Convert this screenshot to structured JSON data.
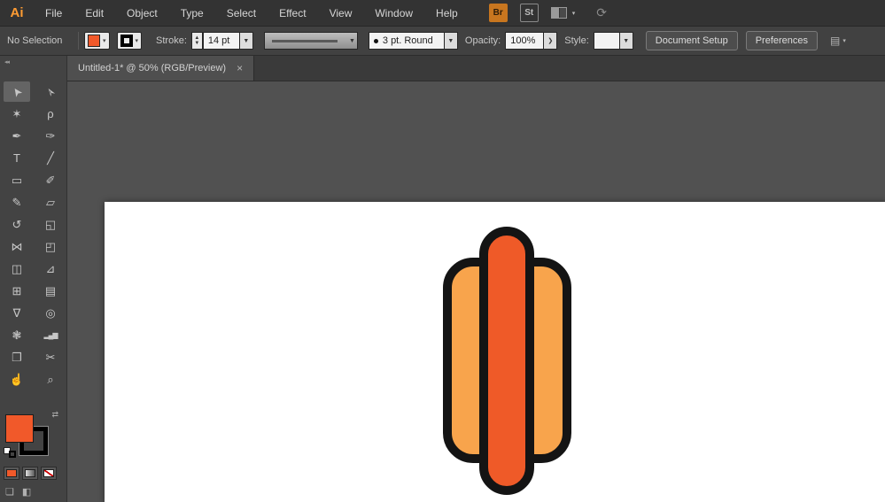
{
  "app": {
    "logo": "Ai",
    "brand_color": "#ff9c33",
    "menu_items": [
      "File",
      "Edit",
      "Object",
      "Type",
      "Select",
      "Effect",
      "View",
      "Window",
      "Help"
    ],
    "topbar": {
      "bridge_label": "Br",
      "stock_label": "St",
      "workspace_chevron": "▾",
      "sync_glyph": "⟳"
    }
  },
  "control_bar": {
    "selection_status": "No Selection",
    "fill_color": "#f1592a",
    "fill_chevron": "▾",
    "stroke_chevron": "▾",
    "stroke_label": "Stroke:",
    "stepper_up": "▲",
    "stepper_down": "▼",
    "stroke_weight_value": "14 pt",
    "stroke_weight_chevron": "▼",
    "profile_chevron": "▼",
    "brush_value": "3 pt. Round",
    "brush_chevron": "▼",
    "opacity_label": "Opacity:",
    "opacity_value": "100%",
    "opacity_arrow": "❯",
    "style_label": "Style:",
    "style_chevron": "▼",
    "document_setup_label": "Document Setup",
    "preferences_label": "Preferences",
    "arrange_glyph": "▤",
    "arrange_chevron": "▾"
  },
  "tab": {
    "title": "Untitled-1* @ 50% (RGB/Preview)",
    "close_glyph": "×"
  },
  "toolbar": {
    "collapse_glyph": "◂◂",
    "swap_glyph": "⇄",
    "fill_color": "#f1592a",
    "stroke_color": "#000000",
    "tools": [
      {
        "name": "selection",
        "glyph": "➤"
      },
      {
        "name": "direct-selection",
        "glyph": "➢"
      },
      {
        "name": "magic-wand",
        "glyph": "✶"
      },
      {
        "name": "lasso",
        "glyph": "ρ"
      },
      {
        "name": "pen",
        "glyph": "✒"
      },
      {
        "name": "curvature",
        "glyph": "✑"
      },
      {
        "name": "type",
        "glyph": "T"
      },
      {
        "name": "line-segment",
        "glyph": "╱"
      },
      {
        "name": "rectangle",
        "glyph": "▭"
      },
      {
        "name": "paintbrush",
        "glyph": "✐"
      },
      {
        "name": "pencil",
        "glyph": "✎"
      },
      {
        "name": "eraser",
        "glyph": "▱"
      },
      {
        "name": "rotate",
        "glyph": "↺"
      },
      {
        "name": "scale",
        "glyph": "◱"
      },
      {
        "name": "width",
        "glyph": "⋈"
      },
      {
        "name": "free-transform",
        "glyph": "◰"
      },
      {
        "name": "shape-builder",
        "glyph": "◫"
      },
      {
        "name": "perspective-grid",
        "glyph": "⊿"
      },
      {
        "name": "mesh",
        "glyph": "⊞"
      },
      {
        "name": "gradient",
        "glyph": "▤"
      },
      {
        "name": "eyedropper",
        "glyph": "∇"
      },
      {
        "name": "blend",
        "glyph": "◎"
      },
      {
        "name": "symbol-sprayer",
        "glyph": "❃"
      },
      {
        "name": "column-graph",
        "glyph": "▂▄▆"
      },
      {
        "name": "artboard",
        "glyph": "❐"
      },
      {
        "name": "slice",
        "glyph": "✂"
      },
      {
        "name": "hand",
        "glyph": "☝"
      },
      {
        "name": "zoom",
        "glyph": "⌕"
      }
    ],
    "draw_mode_glyph": "❏",
    "screen_mode_glyph": "◧"
  },
  "canvas": {
    "background": "#515151",
    "artboard_color": "#ffffff",
    "hotdog": {
      "bun_color": "#f8a44c",
      "sausage_color": "#ef5a28",
      "outline_color": "#141414"
    }
  }
}
